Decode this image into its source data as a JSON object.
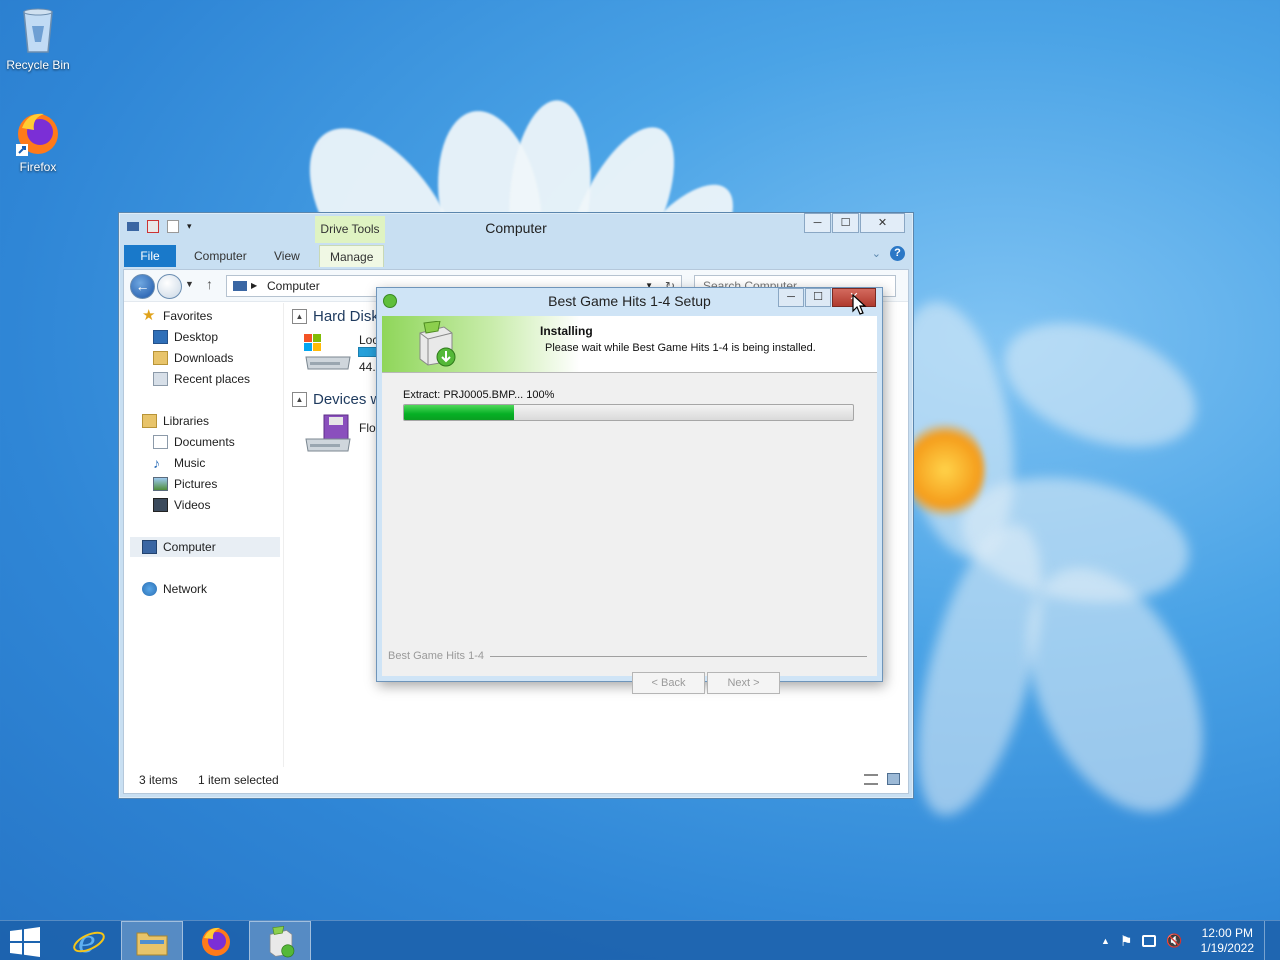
{
  "desktop": {
    "icons": [
      {
        "label": "Recycle Bin",
        "icon": "recycle-bin-icon"
      },
      {
        "label": "Firefox",
        "icon": "firefox-icon"
      }
    ]
  },
  "explorer": {
    "title": "Computer",
    "context_tab": "Drive Tools",
    "tabs": [
      "File",
      "Computer",
      "View",
      "Manage"
    ],
    "address": "Computer",
    "search_placeholder": "Search Computer",
    "nav": {
      "favorites": "Favorites",
      "favorites_items": [
        "Desktop",
        "Downloads",
        "Recent places"
      ],
      "libraries": "Libraries",
      "libraries_items": [
        "Documents",
        "Music",
        "Pictures",
        "Videos"
      ],
      "computer": "Computer",
      "network": "Network"
    },
    "groups": {
      "hard_disk": "Hard Disk",
      "devices": "Devices wi",
      "local_drive_label": "Loc",
      "local_drive_size": "44.0",
      "floppy_label": "Flop"
    },
    "status": {
      "items": "3 items",
      "selected": "1 item selected"
    }
  },
  "setup": {
    "title": "Best Game Hits 1-4 Setup",
    "header_title": "Installing",
    "header_subtitle": "Please wait while Best Game Hits 1-4 is being installed.",
    "status_text": "Extract: PRJ0005.BMP... 100%",
    "progress": 0.245,
    "brand": "Best Game Hits 1-4",
    "back_label": "< Back",
    "next_label": "Next >"
  },
  "taskbar": {
    "time": "12:00 PM",
    "date": "1/19/2022",
    "pinned": [
      "windows-start-icon",
      "internet-explorer-icon",
      "file-explorer-icon",
      "firefox-icon",
      "setup-installer-icon"
    ]
  },
  "colors": {
    "accent": "#1979ca",
    "progress_green": "#06b025",
    "close_red": "#b03a2e"
  }
}
